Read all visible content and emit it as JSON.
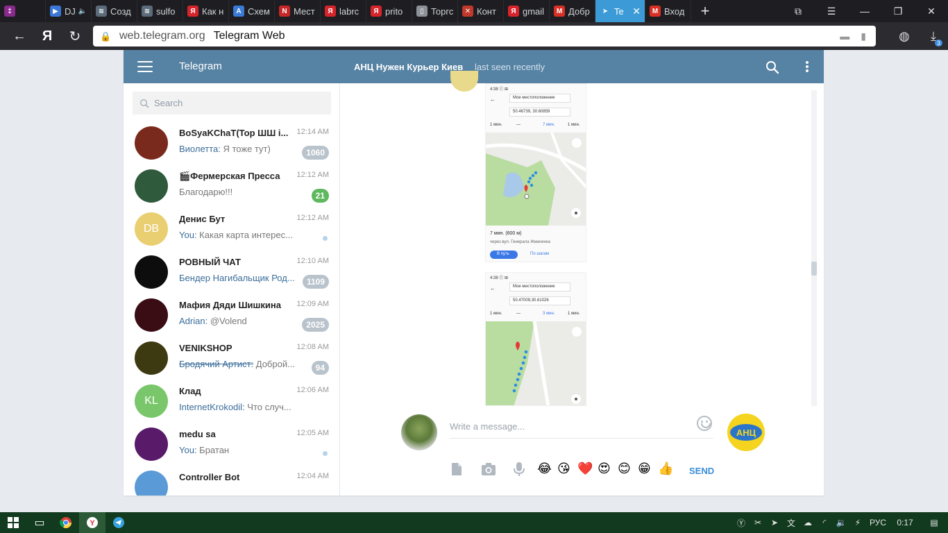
{
  "browser": {
    "tabs": [
      {
        "label": "",
        "color": "#8a2a8c",
        "glyph": "‡"
      },
      {
        "label": "DJ",
        "color": "#3b77d6",
        "glyph": "▶",
        "extra": "🔈"
      },
      {
        "label": "Созд",
        "color": "#5b6b7a",
        "glyph": "≋"
      },
      {
        "label": "sulfo",
        "color": "#5b6b7a",
        "glyph": "≋"
      },
      {
        "label": "Как н",
        "color": "#d6242b",
        "glyph": "Я"
      },
      {
        "label": "Схем",
        "color": "#3a7bd5",
        "glyph": "A"
      },
      {
        "label": "Мест",
        "color": "#c62828",
        "glyph": "N"
      },
      {
        "label": "labrc",
        "color": "#d6242b",
        "glyph": "Я"
      },
      {
        "label": "prito",
        "color": "#d6242b",
        "glyph": "Я"
      },
      {
        "label": "Торгс",
        "color": "#8d9299",
        "glyph": "▯"
      },
      {
        "label": "Конт",
        "color": "#c0392b",
        "glyph": "✕"
      },
      {
        "label": "gmail",
        "color": "#d6242b",
        "glyph": "Я"
      },
      {
        "label": "Добр",
        "color": "#d93025",
        "glyph": "M"
      },
      {
        "label": "Te",
        "color": "#ffffff",
        "glyph": "➤",
        "active": true
      },
      {
        "label": "Вход",
        "color": "#d93025",
        "glyph": "M"
      }
    ],
    "close_glyph": "✕",
    "new_tab_glyph": "+",
    "url_domain": "web.telegram.org",
    "page_title": "Telegram Web",
    "download_count": "3"
  },
  "telegram": {
    "app_title": "Telegram",
    "peer_name": "АНЦ Нужен Курьер Киев",
    "peer_status": "last seen recently",
    "search_placeholder": "Search",
    "composer_placeholder": "Write a message...",
    "send_label": "SEND",
    "peer_photo_text": "АНЦ",
    "accent": "#5682a3",
    "chats": [
      {
        "name": "BoSyaKChaT(Top ШШ i...",
        "time": "12:14 AM",
        "sender": "Виолетта:",
        "text": " Я тоже тут)",
        "badge": "1060",
        "badge_color": "grey",
        "avatar_color": "#7a2a1c",
        "avatar_text": ""
      },
      {
        "name": "🎬Фермерская Пресса",
        "time": "12:12 AM",
        "sender": "",
        "text": "Благодарю!!!",
        "badge": "21",
        "badge_color": "green",
        "avatar_color": "#2f5a3b",
        "avatar_text": ""
      },
      {
        "name": "Денис Бут",
        "time": "12:12 AM",
        "sender": "You:",
        "text": " Какая карта интерес...",
        "badge": "",
        "dot": true,
        "avatar_color": "#e9cf72",
        "avatar_text": "DB"
      },
      {
        "name": "РОВНЫЙ ЧАТ",
        "time": "12:10 AM",
        "sender": "Бендер Нагибальщик Род...",
        "text": "",
        "badge": "1109",
        "badge_color": "grey",
        "avatar_color": "#0d0d0d",
        "avatar_text": ""
      },
      {
        "name": "Мафия Дяди Шишкина",
        "time": "12:09 AM",
        "sender": "Adrian:",
        "text": " @Volend",
        "badge": "2025",
        "badge_color": "grey",
        "avatar_color": "#3a0c14",
        "avatar_text": ""
      },
      {
        "name": "VENIKSHOP",
        "time": "12:08 AM",
        "sender": "Бродячий Артист:",
        "sender_strike": true,
        "text": " Доброй...",
        "badge": "94",
        "badge_color": "grey",
        "avatar_color": "#3d3a12",
        "avatar_text": ""
      },
      {
        "name": "Клад",
        "time": "12:06 AM",
        "sender": "InternetKrokodil:",
        "text": " Что случ...",
        "badge": "",
        "avatar_color": "#7ac66a",
        "avatar_text": "KL"
      },
      {
        "name": "medu sa",
        "time": "12:05 AM",
        "sender": "You:",
        "text": " Братан",
        "badge": "",
        "dot": true,
        "avatar_color": "#5a1a6a",
        "avatar_text": ""
      },
      {
        "name": "Controller Bot",
        "time": "12:04 AM",
        "sender": "",
        "text": "",
        "badge": "",
        "avatar_color": "#5a9ad6",
        "avatar_text": ""
      }
    ],
    "screenshot1": {
      "status": "4:38 ⓒ ⊞",
      "from": "Мое местоположение",
      "to": "50.46739, 30.60859",
      "modes": [
        "1 мин.",
        "—",
        "7 мин.",
        "1 мин."
      ],
      "eta": "7 мин. (600 м)",
      "via": "через вул. Генерала Жмаченка",
      "btn1": "В путь",
      "btn2": "По шагам"
    },
    "screenshot2": {
      "status": "4:38 ⓒ ⊞",
      "from": "Мое местоположение",
      "to": "50.47009,30.61026",
      "modes": [
        "1 мин.",
        "—",
        "3 мин.",
        "1 мин."
      ]
    },
    "emojis": [
      "😂",
      "😘",
      "❤️",
      "😍",
      "😊",
      "😁",
      "👍"
    ]
  },
  "taskbar": {
    "language": "РУС",
    "time": "0:17"
  }
}
